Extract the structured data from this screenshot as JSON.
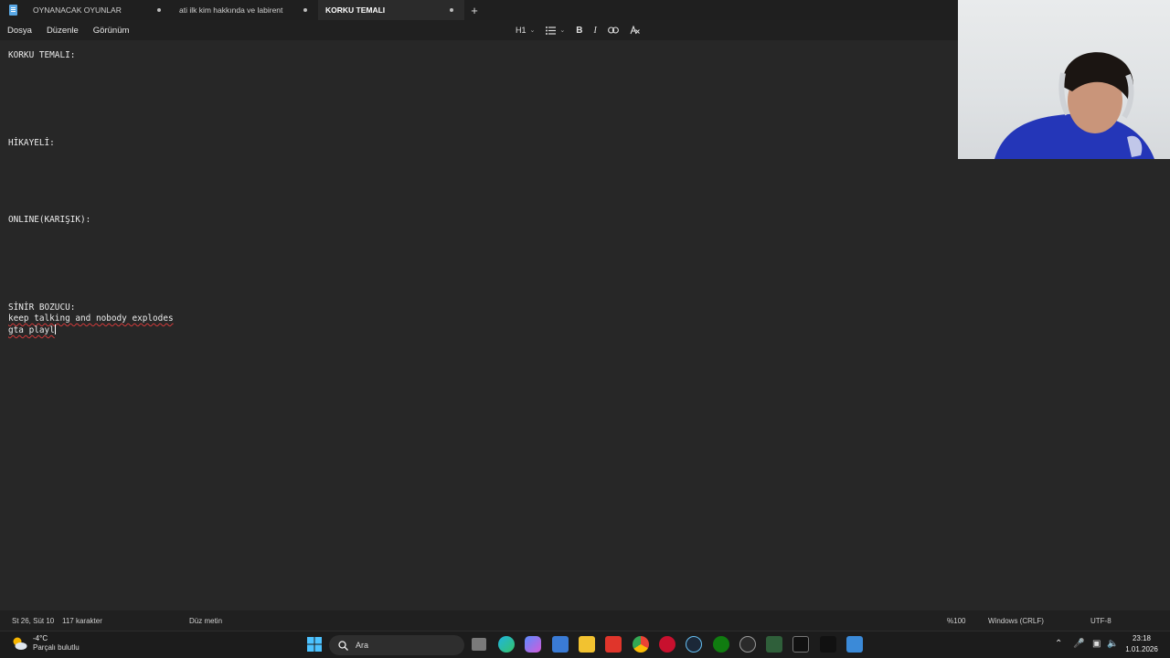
{
  "tabs": [
    {
      "label": "OYNANACAK OYUNLAR",
      "modified": true,
      "active": false
    },
    {
      "label": "ati ilk kim hakkında ve labirent",
      "modified": true,
      "active": false
    },
    {
      "label": "KORKU TEMALI",
      "modified": true,
      "active": true
    }
  ],
  "new_tab_label": "+",
  "menu": [
    "Dosya",
    "Düzenle",
    "Görünüm"
  ],
  "toolbar": {
    "heading": "H1",
    "list_icon": "bulleted-list-icon",
    "bold": "B",
    "italic": "I",
    "link_icon": "link-icon",
    "clear_format_icon": "clear-formatting-icon"
  },
  "editor_lines": {
    "l1": "KORKU TEMALI:",
    "l2": "HİKAYELİ:",
    "l3": "ONLINE(KARIŞIK):",
    "l4": "SİNİR BOZUCU:",
    "l5": "keep talking and nobody explodes",
    "l6": "gta playl"
  },
  "status": {
    "position": "St 26, Süt 10",
    "chars": "117 karakter",
    "format": "Düz metin",
    "zoom": "%100",
    "line_ending": "Windows (CRLF)",
    "encoding": "UTF-8"
  },
  "taskbar": {
    "weather_temp": "-4°C",
    "weather_desc": "Parçalı bulutlu",
    "search_placeholder": "Ara",
    "time": "23:18",
    "date": "1.01.2026"
  },
  "colors": {
    "accent": "#5aa9e6",
    "editor_bg": "#272727",
    "spell_error": "#d03a3a"
  }
}
